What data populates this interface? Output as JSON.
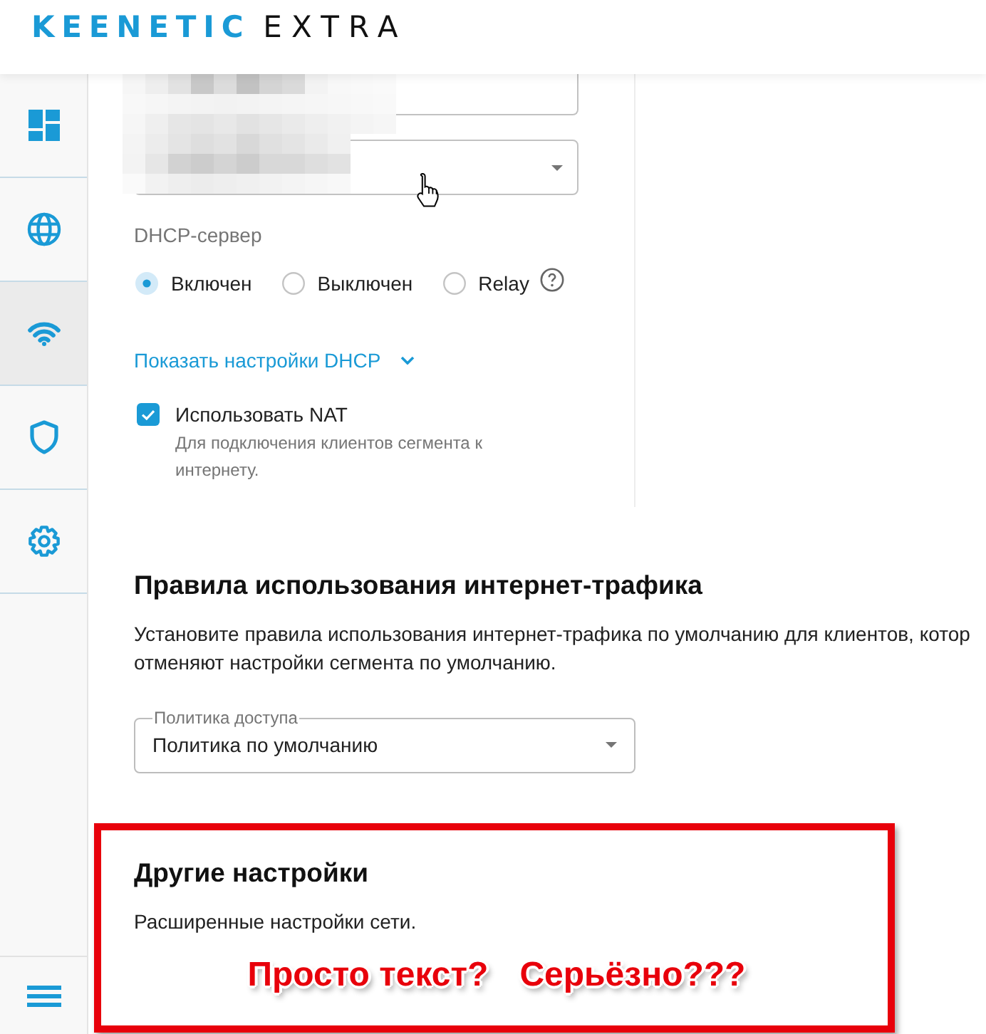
{
  "header": {
    "logo": {
      "brand": "KEENETIC",
      "model": "EXTRA"
    }
  },
  "sidebar": {
    "items": [
      {
        "kind": "dashboard",
        "selected": false
      },
      {
        "kind": "internet",
        "selected": false
      },
      {
        "kind": "wifi",
        "selected": true
      },
      {
        "kind": "security",
        "selected": false
      },
      {
        "kind": "management",
        "selected": false
      }
    ]
  },
  "segment_settings": {
    "fields": [
      {
        "kind": "text"
      },
      {
        "kind": "select"
      }
    ],
    "dhcp_server": {
      "label": "DHCP-сервер",
      "options": [
        {
          "label": "Включен",
          "selected": true
        },
        {
          "label": "Выключен",
          "selected": false
        },
        {
          "label": "Relay",
          "selected": false
        }
      ],
      "help": true
    },
    "dhcp_link": {
      "label": "Показать настройки DHCP",
      "expanded": false
    },
    "nat": {
      "label": "Использовать NAT",
      "checked": true,
      "description": "Для подключения клиентов сегмента к интернету."
    }
  },
  "traffic_rules": {
    "title": "Правила использования интернет-трафика",
    "description": [
      "Установите правила использования интернет-трафика по умолчанию для клиентов, котор",
      "отменяют настройки сегмента по умолчанию."
    ],
    "policy": {
      "label": "Политика доступа",
      "value": "Политика по умолчанию"
    }
  },
  "other_settings": {
    "title": "Другие настройки",
    "description": "Расширенные настройки сети."
  },
  "annotation": {
    "texts": [
      "Просто текст?",
      "Серьёзно???"
    ]
  }
}
